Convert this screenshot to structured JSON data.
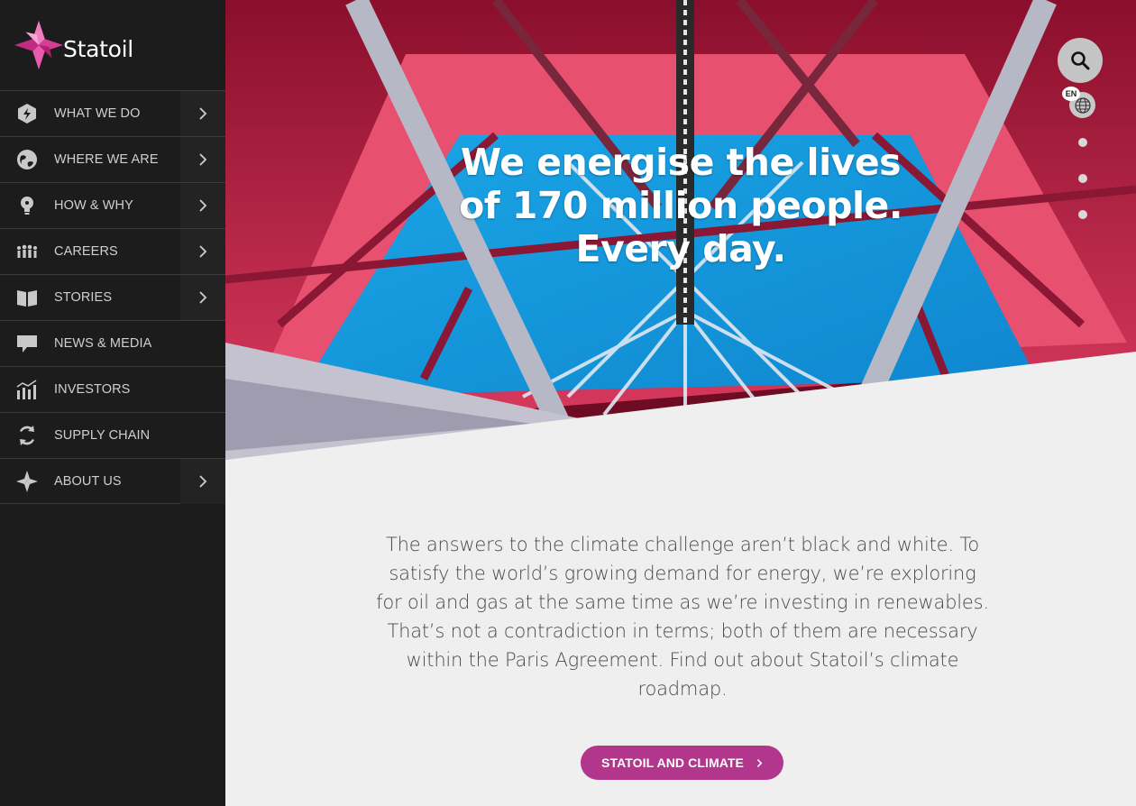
{
  "brand": {
    "name": "Statoil",
    "logo_color": "#e6409f"
  },
  "sidebar": {
    "items": [
      {
        "label": "WHAT WE DO",
        "icon": "hexagon-bolt-icon",
        "has_arrow": true
      },
      {
        "label": "WHERE WE ARE",
        "icon": "globe-icon",
        "has_arrow": true
      },
      {
        "label": "HOW & WHY",
        "icon": "lightbulb-icon",
        "has_arrow": true
      },
      {
        "label": "CAREERS",
        "icon": "people-icon",
        "has_arrow": true
      },
      {
        "label": "STORIES",
        "icon": "book-icon",
        "has_arrow": true
      },
      {
        "label": "NEWS & MEDIA",
        "icon": "speech-bubble-icon",
        "has_arrow": false
      },
      {
        "label": "INVESTORS",
        "icon": "chart-icon",
        "has_arrow": false
      },
      {
        "label": "SUPPLY CHAIN",
        "icon": "cycle-arrows-icon",
        "has_arrow": false
      },
      {
        "label": "ABOUT US",
        "icon": "statoil-star-icon",
        "has_arrow": true
      }
    ]
  },
  "hero": {
    "line1": "We energise the lives",
    "line2": "of 170 million people.",
    "line3": "Every day."
  },
  "header_tools": {
    "search_icon": "search-icon",
    "language": "EN",
    "language_icon": "globe-icon"
  },
  "carousel": {
    "slides": 3
  },
  "intro": {
    "text": "The answers to the climate challenge aren’t black and white. To satisfy the world’s growing demand for energy, we’re exploring for oil and gas at the same time as we’re investing in renewables. That’s not a contradiction in terms; both of them are necessary within the Paris Agreement. Find out about Statoil’s climate roadmap."
  },
  "cta": {
    "label": "STATOIL AND CLIMATE",
    "color": "#b3368d"
  }
}
